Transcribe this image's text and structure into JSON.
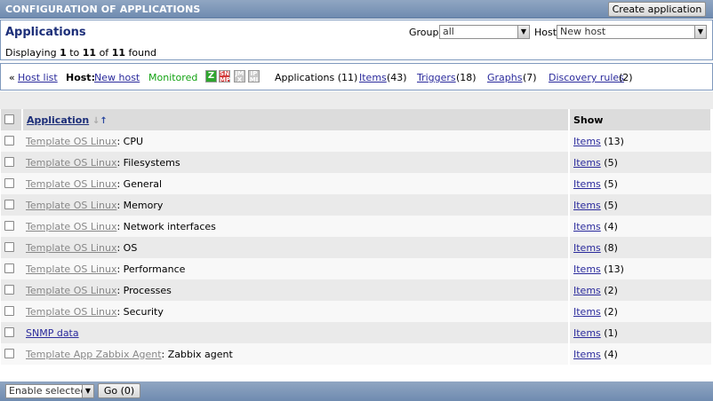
{
  "header": {
    "title": "CONFIGURATION OF APPLICATIONS",
    "create_button": "Create application"
  },
  "filter": {
    "heading": "Applications",
    "group_label": "Group",
    "group_value": "all",
    "host_label": "Host",
    "host_value": "New host",
    "displaying": {
      "prefix": "Displaying",
      "from": "1",
      "to_word": "to",
      "to": "11",
      "of_word": "of",
      "total": "11",
      "suffix": "found"
    }
  },
  "hostbar": {
    "back": "«",
    "host_list": "Host list",
    "host_label": "Host:",
    "host_name": "New host",
    "status": "Monitored",
    "availability": [
      {
        "label": "Z",
        "color": "#2fa52f"
      },
      {
        "label": "SN MP",
        "color": "#d23a3a"
      },
      {
        "label": "JM X",
        "color": "#c8c8c8"
      },
      {
        "label": "IP MI",
        "color": "#c8c8c8"
      }
    ],
    "applications": "Applications (11)",
    "items": {
      "label": "Items",
      "count": "(43)"
    },
    "triggers": {
      "label": "Triggers",
      "count": "(18)"
    },
    "graphs": {
      "label": "Graphs",
      "count": "(7)"
    },
    "discovery": {
      "label": "Discovery rules",
      "count": "(2)"
    }
  },
  "table": {
    "col_application": "Application",
    "col_show": "Show",
    "rows": [
      {
        "template": "Template OS Linux",
        "name": "CPU",
        "items": "Items",
        "count": "(13)"
      },
      {
        "template": "Template OS Linux",
        "name": "Filesystems",
        "items": "Items",
        "count": "(5)"
      },
      {
        "template": "Template OS Linux",
        "name": "General",
        "items": "Items",
        "count": "(5)"
      },
      {
        "template": "Template OS Linux",
        "name": "Memory",
        "items": "Items",
        "count": "(5)"
      },
      {
        "template": "Template OS Linux",
        "name": "Network interfaces",
        "items": "Items",
        "count": "(4)"
      },
      {
        "template": "Template OS Linux",
        "name": "OS",
        "items": "Items",
        "count": "(8)"
      },
      {
        "template": "Template OS Linux",
        "name": "Performance",
        "items": "Items",
        "count": "(13)"
      },
      {
        "template": "Template OS Linux",
        "name": "Processes",
        "items": "Items",
        "count": "(2)"
      },
      {
        "template": "Template OS Linux",
        "name": "Security",
        "items": "Items",
        "count": "(2)"
      },
      {
        "template": "",
        "name": "SNMP data",
        "items": "Items",
        "count": "(1)"
      },
      {
        "template": "Template App Zabbix Agent",
        "name": "Zabbix agent",
        "items": "Items",
        "count": "(4)"
      }
    ]
  },
  "footer": {
    "action": "Enable selected",
    "go": "Go (0)"
  }
}
